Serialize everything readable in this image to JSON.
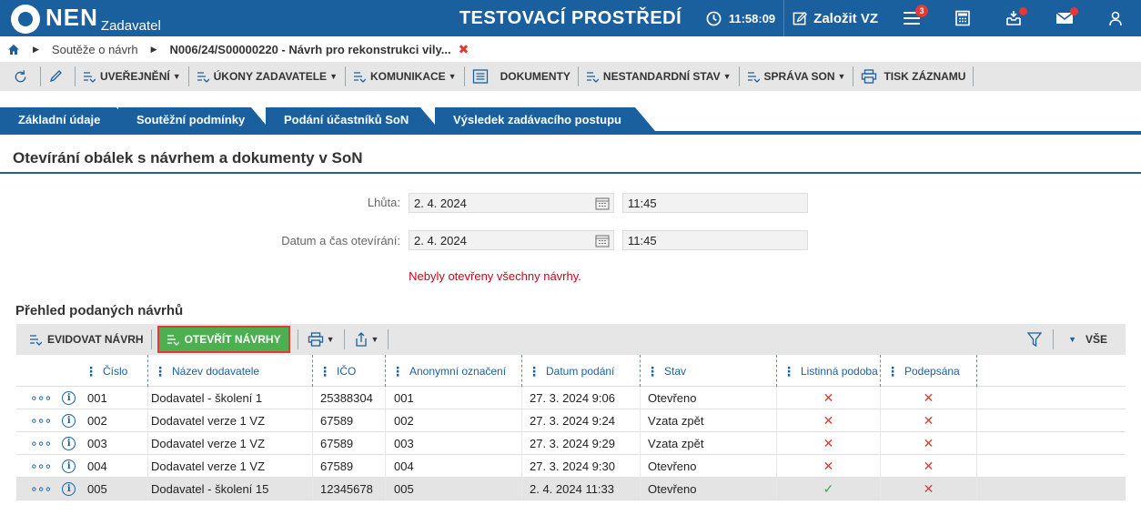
{
  "app": {
    "logo": "NEN",
    "logo_sub": "Zadavatel",
    "env_title": "TESTOVACÍ PROSTŘEDÍ",
    "time": "11:58:09",
    "create_label": "Založit VZ",
    "notifications_count": "3",
    "brand_color": "#1a5f9e"
  },
  "breadcrumb": {
    "items": [
      "Soutěže o návrh",
      "N006/24/S00000220 - Návrh pro rekonstrukci vily..."
    ]
  },
  "toolbar": {
    "items": [
      "UVEŘEJNĚNÍ",
      "ÚKONY ZADAVATELE",
      "KOMUNIKACE",
      "DOKUMENTY",
      "NESTANDARDNÍ STAV",
      "SPRÁVA SON",
      "TISK ZÁZNAMU"
    ]
  },
  "tabs": [
    "Základní údaje",
    "Soutěžní podmínky",
    "Podání účastníků SoN",
    "Výsledek zadávacího postupu"
  ],
  "active_tab": "Podání účastníků SoN",
  "section": {
    "title": "Otevírání obálek s návrhem a dokumenty v SoN"
  },
  "form": {
    "deadline_label": "Lhůta:",
    "deadline_date": "2. 4. 2024",
    "deadline_time": "11:45",
    "opening_label": "Datum a čas otevírání:",
    "opening_date": "2. 4. 2024",
    "opening_time": "11:45"
  },
  "warning": "Nebyly otevřeny všechny návrhy.",
  "grid": {
    "title": "Přehled podaných návrhů",
    "toolbar": {
      "register_label": "EVIDOVAT NÁVRH",
      "open_label": "OTEVŘÍT NÁVRHY",
      "filter_label": "VŠE"
    },
    "columns": [
      "Číslo",
      "Název dodavatele",
      "IČO",
      "Anonymní označení",
      "Datum podání",
      "Stav",
      "Listinná podoba",
      "Podepsána"
    ],
    "rows": [
      {
        "cislo": "001",
        "nazev": "Dodavatel - školení 1",
        "ico": "25388304",
        "anonym": "001",
        "datum": "27. 3. 2024 9:06",
        "stav": "Otevřeno",
        "listinna": "✕",
        "podepsana": "✕"
      },
      {
        "cislo": "002",
        "nazev": "Dodavatel verze 1 VZ",
        "ico": "67589",
        "anonym": "002",
        "datum": "27. 3. 2024 9:24",
        "stav": "Vzata zpět",
        "listinna": "✕",
        "podepsana": "✕"
      },
      {
        "cislo": "003",
        "nazev": "Dodavatel verze 1 VZ",
        "ico": "67589",
        "anonym": "003",
        "datum": "27. 3. 2024 9:29",
        "stav": "Vzata zpět",
        "listinna": "✕",
        "podepsana": "✕"
      },
      {
        "cislo": "004",
        "nazev": "Dodavatel verze 1 VZ",
        "ico": "67589",
        "anonym": "004",
        "datum": "27. 3. 2024 9:30",
        "stav": "Otevřeno",
        "listinna": "✕",
        "podepsana": "✕"
      },
      {
        "cislo": "005",
        "nazev": "Dodavatel - školení 15",
        "ico": "12345678",
        "anonym": "005",
        "datum": "2. 4. 2024 11:33",
        "stav": "Otevřeno",
        "listinna": "✓",
        "podepsana": "✕"
      }
    ]
  }
}
